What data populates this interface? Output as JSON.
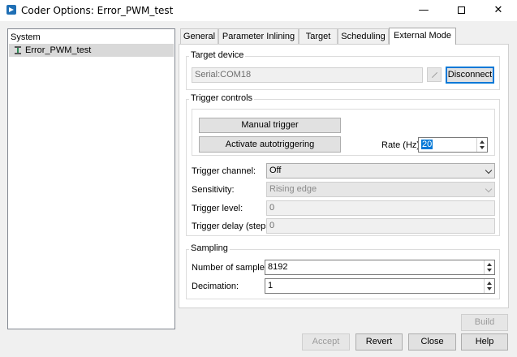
{
  "window": {
    "title": "Coder Options: Error_PWM_test"
  },
  "tree": {
    "header": "System",
    "items": [
      {
        "label": "Error_PWM_test"
      }
    ]
  },
  "tabs": [
    {
      "label": "General"
    },
    {
      "label": "Parameter Inlining"
    },
    {
      "label": "Target"
    },
    {
      "label": "Scheduling"
    },
    {
      "label": "External Mode"
    }
  ],
  "target_device": {
    "group_label": "Target device",
    "port_value": "Serial:COM18",
    "disconnect_label": "Disconnect"
  },
  "trigger_controls": {
    "group_label": "Trigger controls",
    "manual_trigger_label": "Manual trigger",
    "autotrigger_label": "Activate autotriggering",
    "rate_label": "Rate (Hz):",
    "rate_value": "20",
    "channel_label": "Trigger channel:",
    "channel_value": "Off",
    "sensitivity_label": "Sensitivity:",
    "sensitivity_value": "Rising edge",
    "level_label": "Trigger level:",
    "level_value": "0",
    "delay_label": "Trigger delay (steps):",
    "delay_value": "0"
  },
  "sampling": {
    "group_label": "Sampling",
    "samples_label": "Number of samples:",
    "samples_value": "8192",
    "decimation_label": "Decimation:",
    "decimation_value": "1"
  },
  "buttons": {
    "build": "Build",
    "accept": "Accept",
    "revert": "Revert",
    "close": "Close",
    "help": "Help"
  }
}
